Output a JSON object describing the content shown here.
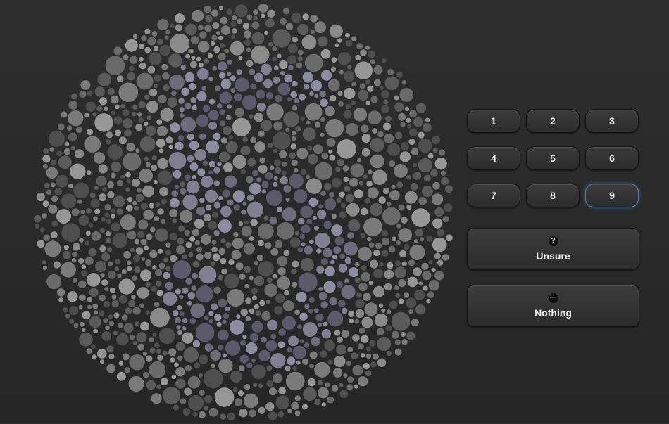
{
  "plate": {
    "background_dot_colors": [
      "#5a5a5a",
      "#6a6a6a",
      "#7a7a7a",
      "#8a8a8a",
      "#4e4e4e",
      "#969696"
    ],
    "figure_dot_colors": [
      "#6e6c7c",
      "#807e90",
      "#5c5a6a",
      "#8e8ca0"
    ]
  },
  "answers": {
    "numbers": [
      "1",
      "2",
      "3",
      "4",
      "5",
      "6",
      "7",
      "8",
      "9"
    ],
    "selected": "9",
    "unsure": {
      "label": "Unsure",
      "icon": "question-icon",
      "glyph": "?"
    },
    "nothing": {
      "label": "Nothing",
      "icon": "ellipsis-icon",
      "glyph": "···"
    }
  },
  "colors": {
    "focus_ring": "#4a7fb0",
    "button_text": "#f2f2f2"
  }
}
